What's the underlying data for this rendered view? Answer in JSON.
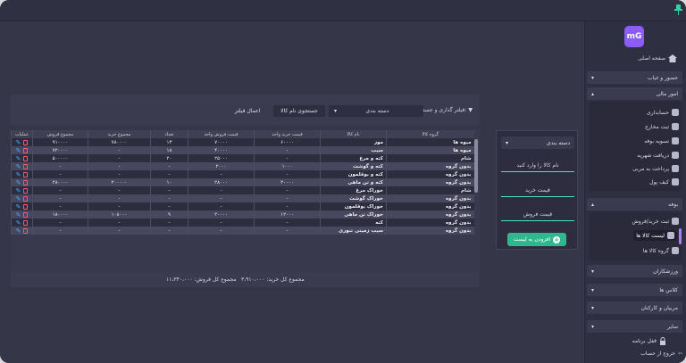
{
  "filter": {
    "label": "فیلتر گذاری و جستجو:",
    "category_value": "دسته بندی",
    "search_value": "جستجوی نام کالا",
    "apply_label": "اعمال فیلتر"
  },
  "table": {
    "headers": [
      "گروه کالا",
      "نام کالا",
      "قیمت خرید واحد",
      "قیمت فروش واحد",
      "تعداد",
      "مجموع خرید",
      "مجموع فروش",
      "عملیات"
    ],
    "rows": [
      [
        "میوه ها",
        "موز",
        "۶۰۰۰۰",
        "۷۰۰۰۰",
        "۱۳",
        "۷۸۰۰۰۰",
        "۹۱۰۰۰۰"
      ],
      [
        "میوه ها",
        "سیب",
        "-",
        "۴۰۰۰۰",
        "۱۸",
        "-",
        "۷۲۰۰۰۰"
      ],
      [
        "شام",
        "کته و مرغ",
        "-",
        "۲۵۰۰۰",
        "۲۰",
        "-",
        "۵۰۰۰۰۰"
      ],
      [
        "بدون گروه",
        "کته و گوشت",
        "۱۰۰۰",
        "۲۰۰۰",
        "-",
        "-",
        "-"
      ],
      [
        "بدون گروه",
        "کته و بوقلمون",
        "-",
        "-",
        "-",
        "-",
        "-"
      ],
      [
        "بدون گروه",
        "کته و تن ماهی",
        "۲۰۰۰۰",
        "۲۸۰۰۰",
        "۱۰",
        "۲۰۰۰۰۰",
        "۲۸۰۰۰۰"
      ],
      [
        "شام",
        "خوراک مرغ",
        "-",
        "-",
        "-",
        "-",
        "-"
      ],
      [
        "بدون گروه",
        "خوراک گوشت",
        "-",
        "-",
        "-",
        "-",
        "-"
      ],
      [
        "بدون گروه",
        "خوراک بوقلمون",
        "-",
        "-",
        "-",
        "-",
        "-"
      ],
      [
        "بدون گروه",
        "خوراک تن ماهی",
        "۱۲۰۰۰",
        "۲۰۰۰۰",
        "۹",
        "۱۰۸۰۰۰",
        "۱۸۰۰۰۰"
      ],
      [
        "بدون گروه",
        "کته",
        "-",
        "-",
        "-",
        "-",
        "-"
      ],
      [
        "بدون گروه",
        "سیب زمینی تنوری",
        "-",
        "-",
        "-",
        "-",
        "-"
      ]
    ]
  },
  "totals": {
    "purchase": "مجموع کل خرید: ۳،۹۱۰،۰۰۰",
    "sales": "مجموع کل فروش: ۱۱،۳۴۰،۰۰۰"
  },
  "form": {
    "category": "دسته بندی",
    "name_placeholder": "نام کالا را وارد کنید",
    "buy_placeholder": "قیمت خرید",
    "sell_placeholder": "قیمت فروش",
    "add_label": "افزودن به لیست"
  },
  "sidebar": {
    "logo": "mG",
    "home": "صفحه اصلی",
    "attendance": "حضور و غیاب",
    "finance": "امور مالی",
    "finance_items": [
      "حسابداری",
      "ثبت مخارج",
      "تسویه بوفه",
      "دریافت شهریه",
      "پرداخت به مربی",
      "کیف پول"
    ],
    "buffet": "بوفه",
    "buffet_items": [
      "ثبت خرید/فروش",
      "لیست کالا ها",
      "گروه کالا ها"
    ],
    "athletes": "ورزشکاران",
    "classes": "کلاس ها",
    "coaches": "مربیان و کارکنان",
    "other": "سایر",
    "lock": "قفل برنامه",
    "logout": "خروج از حساب"
  }
}
